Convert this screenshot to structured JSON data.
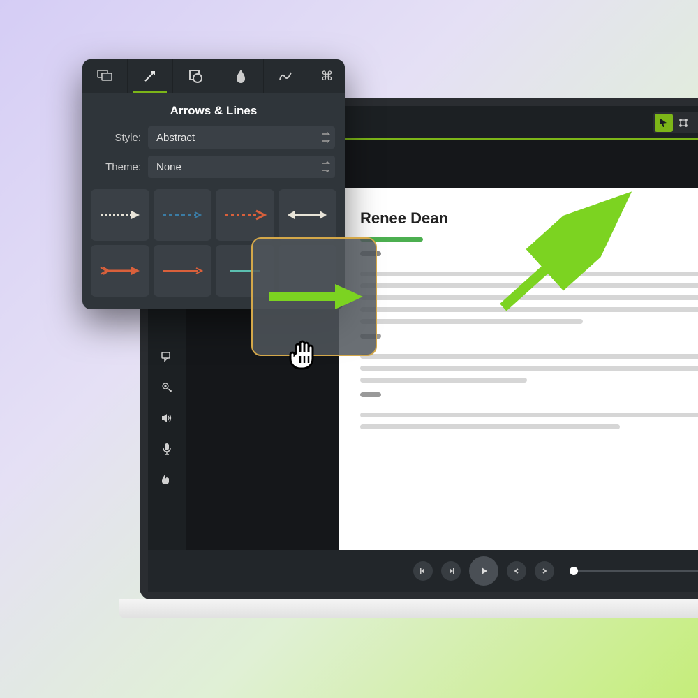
{
  "popup": {
    "title": "Arrows & Lines",
    "style_label": "Style:",
    "style_value": "Abstract",
    "theme_label": "Theme:",
    "theme_value": "None"
  },
  "document": {
    "heading": "Renee Dean"
  },
  "colors": {
    "accent": "#7cb518",
    "orange": "#d9603b",
    "blue": "#3a7ca5",
    "teal": "#5bbfb0"
  }
}
